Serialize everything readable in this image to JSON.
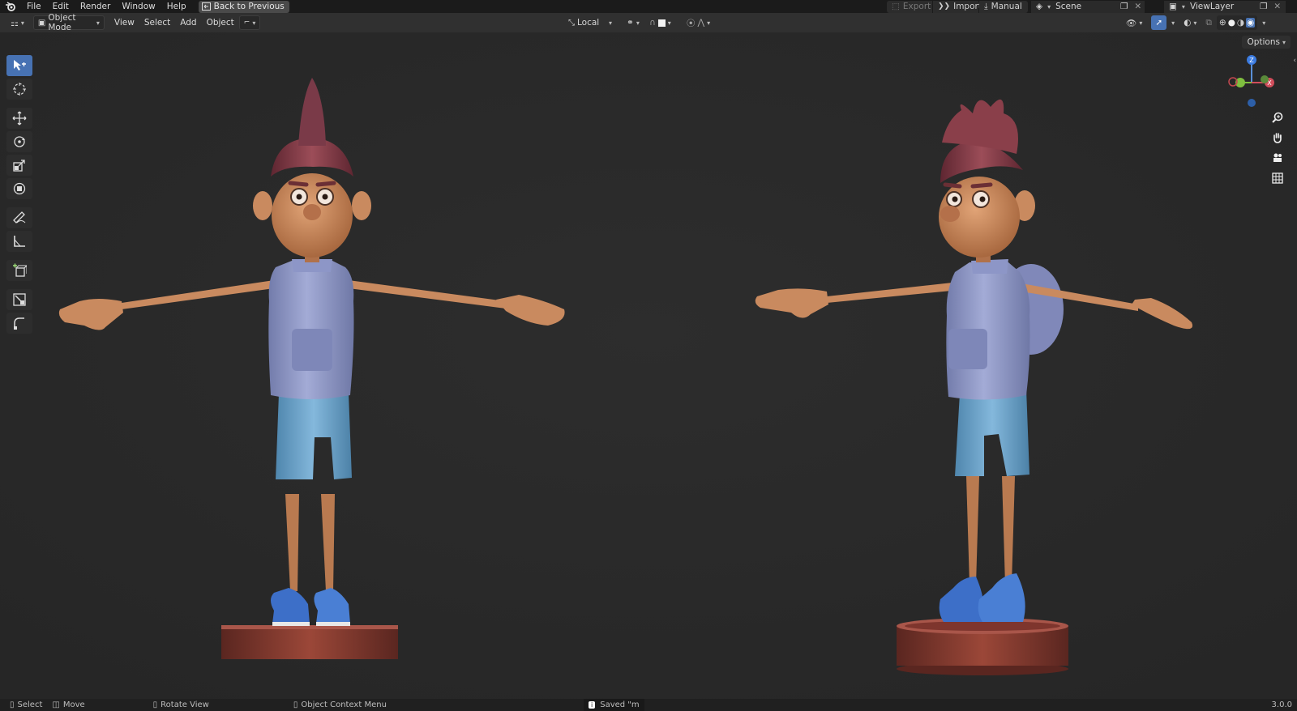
{
  "menubar": {
    "items": [
      "File",
      "Edit",
      "Render",
      "Window",
      "Help"
    ],
    "back_button": "Back to Previous",
    "export_label": "Export",
    "import_label": "Import",
    "manual_label": "Manual",
    "scene_name": "Scene",
    "viewlayer_name": "ViewLayer"
  },
  "header": {
    "mode": "Object Mode",
    "menus": [
      "View",
      "Select",
      "Add",
      "Object"
    ],
    "transform_orientation": "Local",
    "options_label": "Options"
  },
  "statusbar": {
    "select": "Select",
    "move": "Move",
    "rotate_view": "Rotate View",
    "context_menu": "Object Context Menu",
    "saved_message": "Saved \"m",
    "version": "3.0.0"
  },
  "colors": {
    "accent": "#4772b3",
    "viewport_bg": "#2a2a2a",
    "skin": "#c98a5f",
    "hair": "#8a3f4a",
    "shirt": "#8c95c6",
    "shorts": "#6fa4c9",
    "shoes": "#3d6fc8",
    "base": "#8c3c34"
  }
}
